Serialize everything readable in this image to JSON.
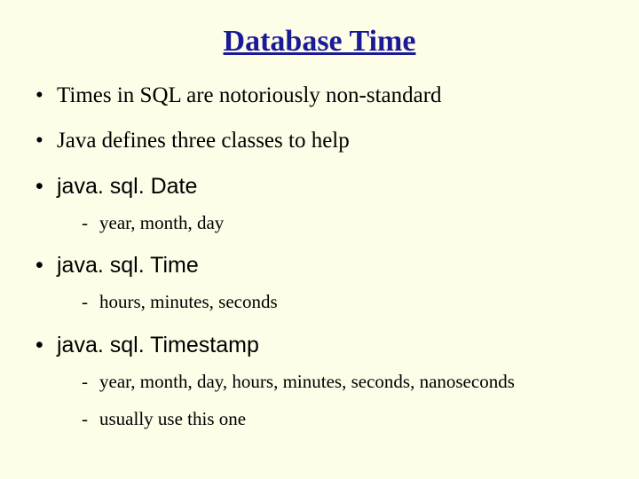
{
  "slide": {
    "title": "Database Time",
    "bullets": [
      {
        "text": "Times in SQL are notoriously non-standard"
      },
      {
        "text": "Java defines three classes to help"
      },
      {
        "text": "java. sql. Date",
        "sub": [
          "year, month, day"
        ]
      },
      {
        "text": "java. sql. Time",
        "sub": [
          "hours, minutes, seconds"
        ]
      },
      {
        "text": "java. sql. Timestamp",
        "sub": [
          "year, month, day, hours, minutes, seconds, nanoseconds",
          "usually use this one"
        ]
      }
    ]
  }
}
